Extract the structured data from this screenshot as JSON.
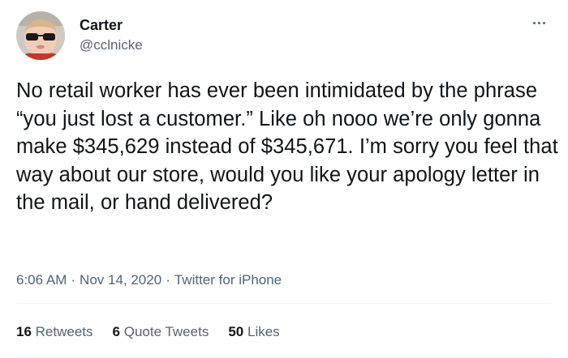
{
  "author": {
    "display_name": "Carter",
    "handle": "@cclnicke",
    "avatar_icon": "child-with-sunglasses-avatar"
  },
  "menu": {
    "icon": "more-horizontal-icon"
  },
  "tweet": {
    "text": "No retail worker has ever been intimidated by the phrase “you just lost a customer.” Like oh nooo we’re only gonna make $345,629 instead of $345,671. I’m sorry you feel that way about our store, would you like your apology letter in the mail, or hand delivered?"
  },
  "meta": {
    "time": "6:06 AM",
    "separator": "·",
    "date": "Nov 14, 2020",
    "source": "Twitter for iPhone"
  },
  "stats": {
    "retweets_count": "16",
    "retweets_label": "Retweets",
    "quote_count": "6",
    "quote_label": "Quote Tweets",
    "likes_count": "50",
    "likes_label": "Likes"
  },
  "colors": {
    "primary_text": "#0f1419",
    "secondary_text": "#536471",
    "divider": "#eff3f4"
  }
}
